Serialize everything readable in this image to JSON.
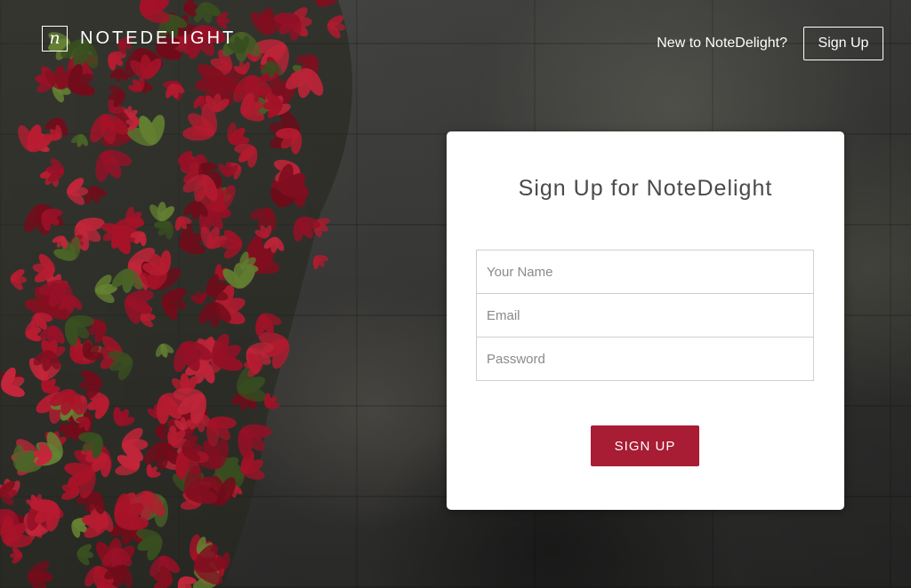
{
  "header": {
    "logo_glyph": "n",
    "brand_name": "NOTEDELIGHT",
    "new_user_text": "New to NoteDelight?",
    "signup_link_label": "Sign Up"
  },
  "signup_card": {
    "title": "Sign Up for NoteDelight",
    "fields": {
      "name_placeholder": "Your Name",
      "email_placeholder": "Email",
      "password_placeholder": "Password"
    },
    "submit_label": "SIGN UP"
  },
  "colors": {
    "accent": "#a81c34",
    "card_bg": "#ffffff",
    "header_text": "#ffffff",
    "leaf_red": "#b3142b"
  },
  "background": {
    "description_icon": "red-ivy-on-stone-wall-photo"
  }
}
